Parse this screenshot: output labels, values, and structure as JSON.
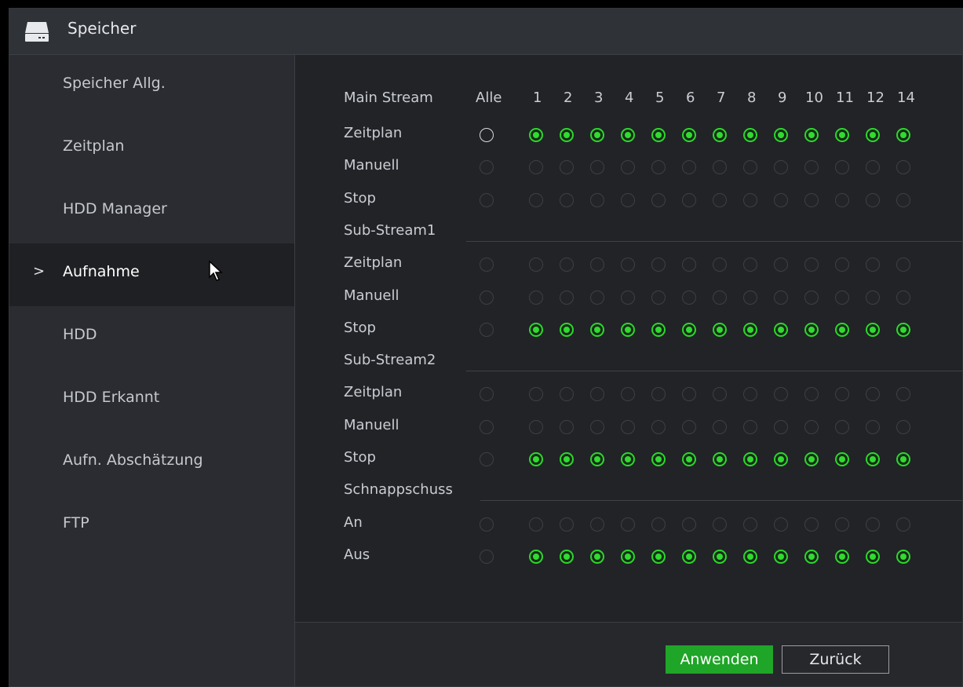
{
  "window": {
    "title": "Speicher"
  },
  "sidebar": {
    "items": [
      {
        "label": "Speicher Allg.",
        "active": false
      },
      {
        "label": "Zeitplan",
        "active": false
      },
      {
        "label": "HDD Manager",
        "active": false
      },
      {
        "label": "Aufnahme",
        "active": true
      },
      {
        "label": "HDD",
        "active": false
      },
      {
        "label": "HDD Erkannt",
        "active": false
      },
      {
        "label": "Aufn. Abschätzung",
        "active": false
      },
      {
        "label": "FTP",
        "active": false
      }
    ],
    "active_marker": ">"
  },
  "grid": {
    "header": {
      "label": "Main Stream",
      "all_label": "Alle",
      "channels": [
        "1",
        "2",
        "3",
        "4",
        "5",
        "6",
        "7",
        "8",
        "9",
        "10",
        "11",
        "12",
        "14"
      ]
    },
    "sections": [
      {
        "title": "",
        "rows": [
          {
            "label": "Zeitplan",
            "alle": "white",
            "state": "on"
          },
          {
            "label": "Manuell",
            "alle": "off",
            "state": "off"
          },
          {
            "label": "Stop",
            "alle": "off",
            "state": "off"
          }
        ]
      },
      {
        "title": "Sub-Stream1",
        "rows": [
          {
            "label": "Zeitplan",
            "alle": "off",
            "state": "off"
          },
          {
            "label": "Manuell",
            "alle": "off",
            "state": "off"
          },
          {
            "label": "Stop",
            "alle": "off",
            "state": "on"
          }
        ]
      },
      {
        "title": "Sub-Stream2",
        "rows": [
          {
            "label": "Zeitplan",
            "alle": "off",
            "state": "off"
          },
          {
            "label": "Manuell",
            "alle": "off",
            "state": "off"
          },
          {
            "label": "Stop",
            "alle": "off",
            "state": "on"
          }
        ]
      },
      {
        "title": "Schnappschuss",
        "rows": [
          {
            "label": "An",
            "alle": "off",
            "state": "off"
          },
          {
            "label": "Aus",
            "alle": "off",
            "state": "on"
          }
        ]
      }
    ]
  },
  "footer": {
    "apply_label": "Anwenden",
    "back_label": "Zurück"
  },
  "colors": {
    "accent_green": "#1fa527",
    "radio_on": "#2fdc2f"
  },
  "icons": {
    "title": "hdd-icon",
    "cursor": "mouse-cursor-icon"
  }
}
